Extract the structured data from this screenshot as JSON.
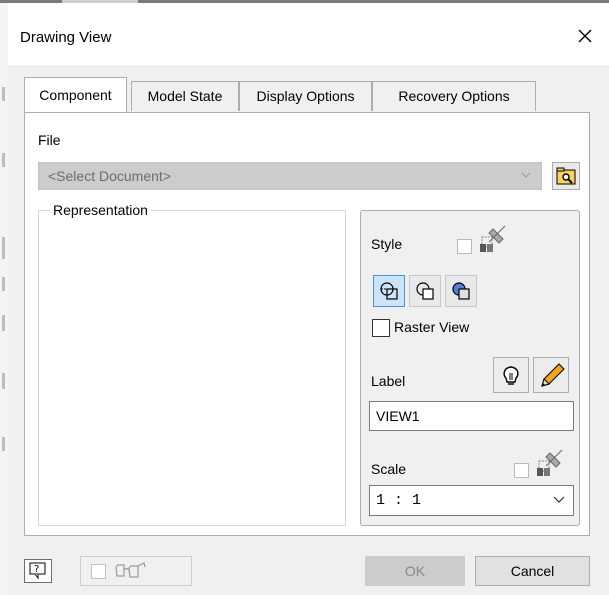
{
  "window": {
    "title": "Drawing View"
  },
  "tabs": [
    {
      "label": "Component",
      "active": true
    },
    {
      "label": "Model State",
      "active": false
    },
    {
      "label": "Display Options",
      "active": false
    },
    {
      "label": "Recovery Options",
      "active": false
    }
  ],
  "file": {
    "label": "File",
    "placeholder": "<Select Document>",
    "enabled": false,
    "browse_icon": "folder-browse-icon"
  },
  "representation": {
    "title": "Representation"
  },
  "style": {
    "label": "Style",
    "link_checked": false,
    "buttons": [
      {
        "name": "hidden-line",
        "icon": "hidden-line-icon",
        "selected": true
      },
      {
        "name": "hidden-line-removed",
        "icon": "hidden-line-removed-icon",
        "selected": false
      },
      {
        "name": "shaded",
        "icon": "shaded-icon",
        "selected": false
      }
    ]
  },
  "raster": {
    "label": "Raster View",
    "checked": false
  },
  "label_section": {
    "label": "Label",
    "value": "VIEW1",
    "visibility_icon": "lightbulb-icon",
    "edit_icon": "pencil-icon"
  },
  "scale": {
    "label": "Scale",
    "value": "1 : 1",
    "link_checked": false
  },
  "footer": {
    "help_icon": "help-icon",
    "glasses_icon": "glasses-icon",
    "ok_label": "OK",
    "ok_enabled": false,
    "cancel_label": "Cancel"
  },
  "colors": {
    "selection": "#cce4f7",
    "selection_border": "#4f94d8",
    "pencil": "#f2a51a",
    "folder": "#f4d35e"
  }
}
